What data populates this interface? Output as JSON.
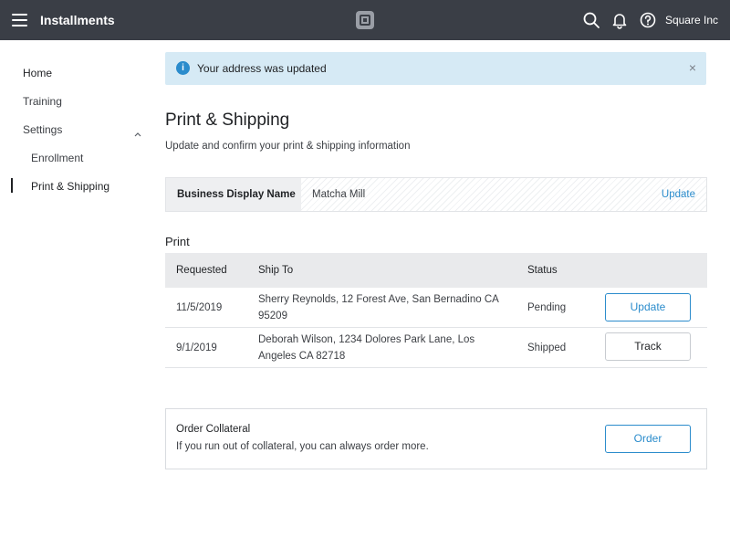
{
  "topbar": {
    "title": "Installments",
    "merchant_name": "Square Inc",
    "icons": [
      "menu-icon",
      "square-logo",
      "search-icon",
      "bell-icon",
      "help-icon"
    ]
  },
  "sidebar": {
    "items": [
      {
        "label": "Home"
      },
      {
        "label": "Training"
      },
      {
        "label": "Settings"
      },
      {
        "label": "Enrollment"
      },
      {
        "label": "Print & Shipping"
      }
    ],
    "active": "Print & Shipping"
  },
  "alert": {
    "icon": "info-icon",
    "icon_glyph": "i",
    "message": "Your address was updated",
    "close_glyph": "×"
  },
  "page": {
    "title": "Print & Shipping",
    "subtitle": "Update and confirm your print & shipping information"
  },
  "business": {
    "label": "Business Display Name",
    "value": "Matcha Mill",
    "action": "Update"
  },
  "print": {
    "title": "Print",
    "columns": [
      "Requested",
      "Ship To",
      "Status",
      ""
    ],
    "rows": [
      {
        "requested": "11/5/2019",
        "ship_to_line1": "Sherry Reynolds, 12 Forest Ave, San Bernadino CA",
        "ship_to_line2": "95209",
        "status": "Pending",
        "action": "Update"
      },
      {
        "requested": "9/1/2019",
        "ship_to_line1": "Deborah Wilson, 1234 Dolores Park Lane, Los",
        "ship_to_line2": "Angeles CA 82718",
        "status": "Shipped",
        "action": "Track"
      }
    ]
  },
  "order": {
    "title": "Order Collateral",
    "description": "If you run out of collateral, you can always order more.",
    "button": "Order"
  },
  "colors": {
    "topbar": "#3a3e46",
    "accent": "#2b8ccc",
    "alert_bg": "#d6eaf5"
  }
}
